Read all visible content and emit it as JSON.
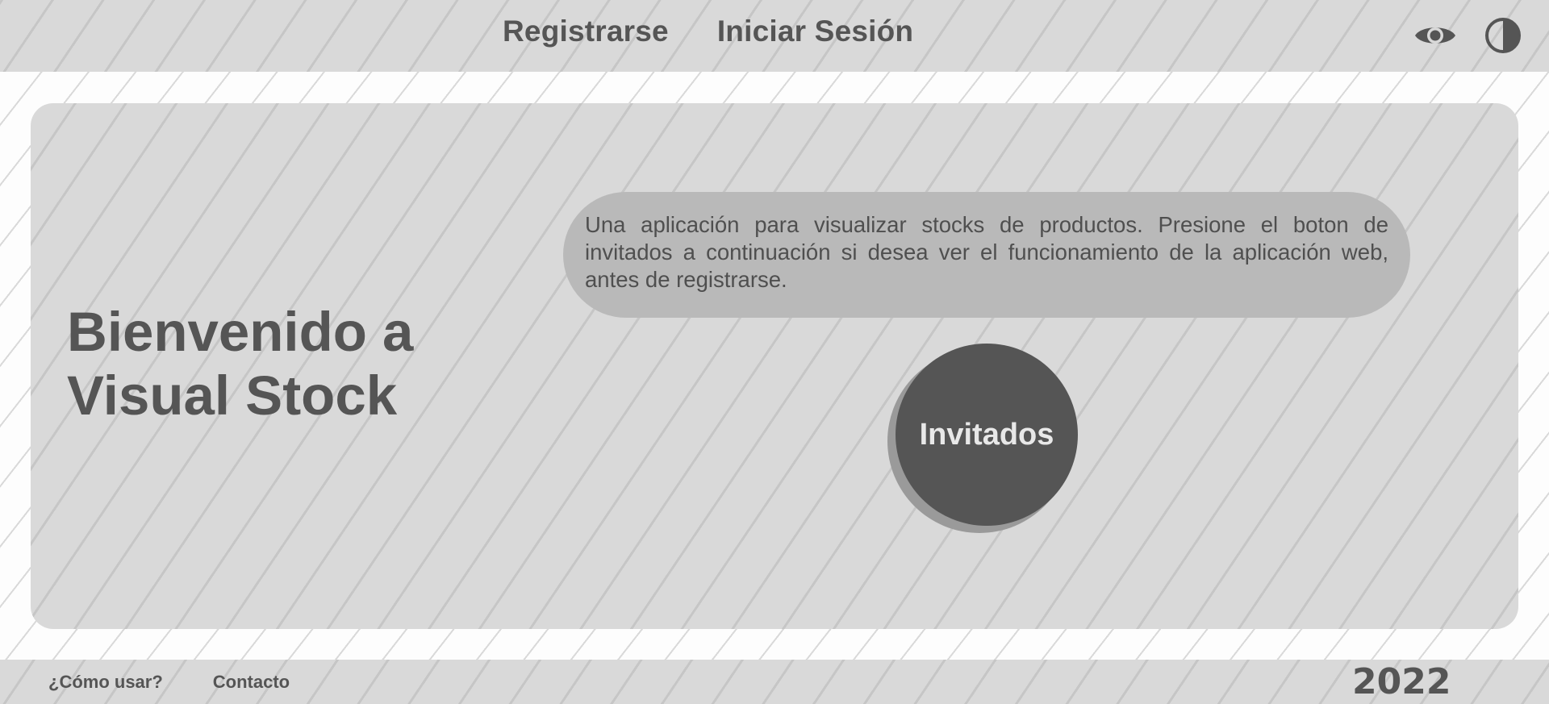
{
  "header": {
    "nav": {
      "register_label": "Registrarse",
      "login_label": "Iniciar Sesión"
    },
    "icons": {
      "visibility": "eye-icon",
      "contrast": "contrast-icon"
    }
  },
  "main": {
    "welcome_line1": "Bienvenido a",
    "welcome_line2": "Visual Stock",
    "description": "Una aplicación para visualizar stocks de productos. Presione el boton de invitados a continuación si desea ver el funcionamiento de la aplicación web, antes de registrarse.",
    "guest_button_label": "Invitados"
  },
  "footer": {
    "how_to_label": "¿Cómo usar?",
    "contact_label": "Contacto",
    "year": "2022"
  },
  "colors": {
    "header_bg": "#d9d9d9",
    "panel_bg": "#d9d9d9",
    "desc_box_bg": "#b9b9b9",
    "guest_button_bg": "#555555",
    "text": "#555555"
  }
}
